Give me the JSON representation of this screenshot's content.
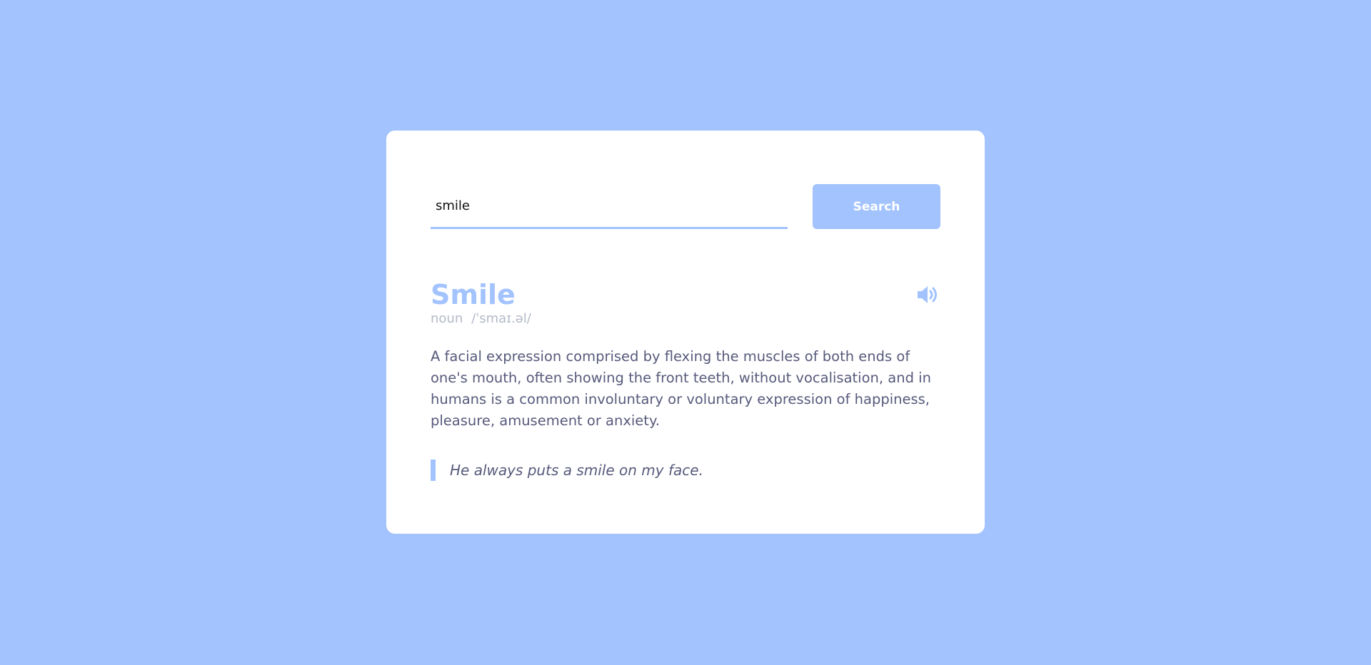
{
  "search": {
    "value": "smile",
    "button_label": "Search"
  },
  "result": {
    "word": "Smile",
    "part_of_speech": "noun",
    "phonetic": "/ˈsmaɪ.əl/",
    "definition": "A facial expression comprised by flexing the muscles of both ends of one's mouth, often showing the front teeth, without vocalisation, and in humans is a common involuntary or voluntary expression of happiness, pleasure, amusement or anxiety.",
    "example": "He always puts a smile on my face."
  },
  "icons": {
    "audio": "speaker-volume-icon"
  },
  "colors": {
    "background": "#a2c3fe",
    "accent": "#a2c3fe",
    "card": "#ffffff",
    "text": "#575a7b",
    "muted": "#b4b9c8"
  }
}
